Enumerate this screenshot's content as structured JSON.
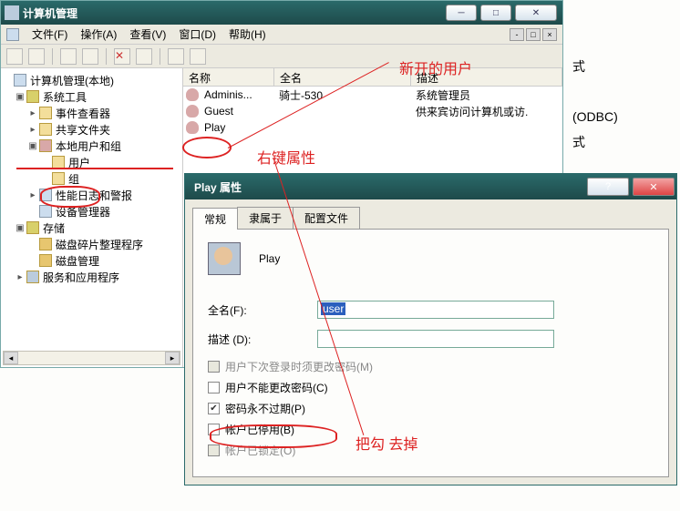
{
  "title": "计算机管理",
  "menu": {
    "file": "文件(F)",
    "action": "操作(A)",
    "view": "查看(V)",
    "window": "窗口(D)",
    "help": "帮助(H)"
  },
  "tree": {
    "root": "计算机管理(本地)",
    "sys_tools": "系统工具",
    "event_viewer": "事件查看器",
    "shared_folders": "共享文件夹",
    "local_users": "本地用户和组",
    "users": "用户",
    "groups": "组",
    "perf": "性能日志和警报",
    "device": "设备管理器",
    "storage": "存储",
    "defrag": "磁盘碎片整理程序",
    "disk": "磁盘管理",
    "services": "服务和应用程序"
  },
  "list": {
    "col_name": "名称",
    "col_full": "全名",
    "col_desc": "描述",
    "rows": [
      {
        "name": "Adminis...",
        "full": "骑士-530",
        "desc": "系统管理员"
      },
      {
        "name": "Guest",
        "full": "",
        "desc": "供来宾访问计算机或访."
      },
      {
        "name": "Play",
        "full": "",
        "desc": ""
      }
    ]
  },
  "dialog": {
    "title": "Play 属性",
    "tab_general": "常规",
    "tab_member": "隶属于",
    "tab_profile": "配置文件",
    "username": "Play",
    "fullname_label": "全名(F):",
    "fullname_value": "user",
    "desc_label": "描述 (D):",
    "chk_must_change": "用户下次登录时须更改密码(M)",
    "chk_cannot_change": "用户不能更改密码(C)",
    "chk_never_expire": "密码永不过期(P)",
    "chk_disabled": "帐户已停用(B)",
    "chk_locked": "帐户已锁定(O)"
  },
  "annotations": {
    "new_user": "新开的用户",
    "right_click": "右键属性",
    "uncheck": "把勾 去掉"
  },
  "bg": {
    "odbc": "(ODBC)"
  }
}
